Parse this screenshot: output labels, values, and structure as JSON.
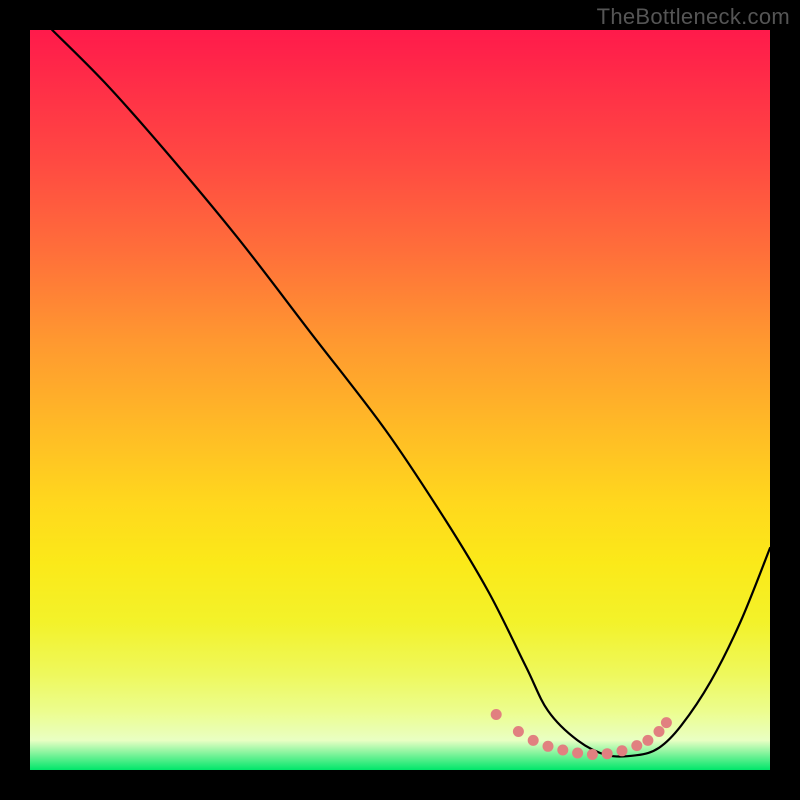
{
  "watermark": "TheBottleneck.com",
  "chart_data": {
    "type": "line",
    "title": "",
    "xlabel": "",
    "ylabel": "",
    "xlim": [
      0,
      100
    ],
    "ylim": [
      0,
      100
    ],
    "series": [
      {
        "name": "bottleneck-curve",
        "x": [
          3,
          10,
          18,
          28,
          38,
          48,
          56,
          62,
          67,
          70,
          74,
          78,
          82,
          85,
          88,
          92,
          96,
          100
        ],
        "y": [
          100,
          93,
          84,
          72,
          59,
          46,
          34,
          24,
          14,
          8,
          4,
          2,
          2,
          3,
          6,
          12,
          20,
          30
        ]
      }
    ],
    "highlight": {
      "name": "optimal-range",
      "points": [
        {
          "x": 63,
          "y": 7.5
        },
        {
          "x": 66,
          "y": 5.2
        },
        {
          "x": 68,
          "y": 4.0
        },
        {
          "x": 70,
          "y": 3.2
        },
        {
          "x": 72,
          "y": 2.7
        },
        {
          "x": 74,
          "y": 2.3
        },
        {
          "x": 76,
          "y": 2.1
        },
        {
          "x": 78,
          "y": 2.2
        },
        {
          "x": 80,
          "y": 2.6
        },
        {
          "x": 82,
          "y": 3.3
        },
        {
          "x": 83.5,
          "y": 4.0
        },
        {
          "x": 85,
          "y": 5.2
        },
        {
          "x": 86,
          "y": 6.4
        }
      ]
    },
    "colors": {
      "curve": "#000000",
      "highlight": "#e18080",
      "gradient_top": "#ff1a4b",
      "gradient_bottom": "#00e66a"
    }
  }
}
